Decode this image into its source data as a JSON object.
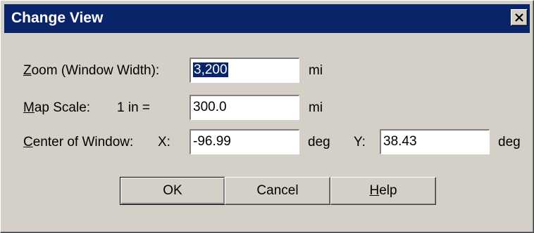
{
  "dialog": {
    "title": "Change View",
    "close_glyph": "✕"
  },
  "zoom": {
    "label_mnemonic": "Z",
    "label_rest": "oom (Window Width):",
    "value": "3,200",
    "unit": "mi"
  },
  "map_scale": {
    "label_mnemonic": "M",
    "label_rest": "ap Scale:",
    "prefix": "1 in =",
    "value": "300.0",
    "unit": "mi"
  },
  "center": {
    "label_mnemonic": "C",
    "label_rest": "enter of Window:",
    "x_label": "X:",
    "x_value": "-96.99",
    "x_unit": "deg",
    "y_label": "Y:",
    "y_value": "38.43",
    "y_unit": "deg"
  },
  "buttons": {
    "ok": "OK",
    "cancel": "Cancel",
    "help_mnemonic": "H",
    "help_rest": "elp"
  },
  "colors": {
    "face": "#d4d0c8",
    "titlebar": "#0a246a",
    "selection": "#0a246a"
  }
}
